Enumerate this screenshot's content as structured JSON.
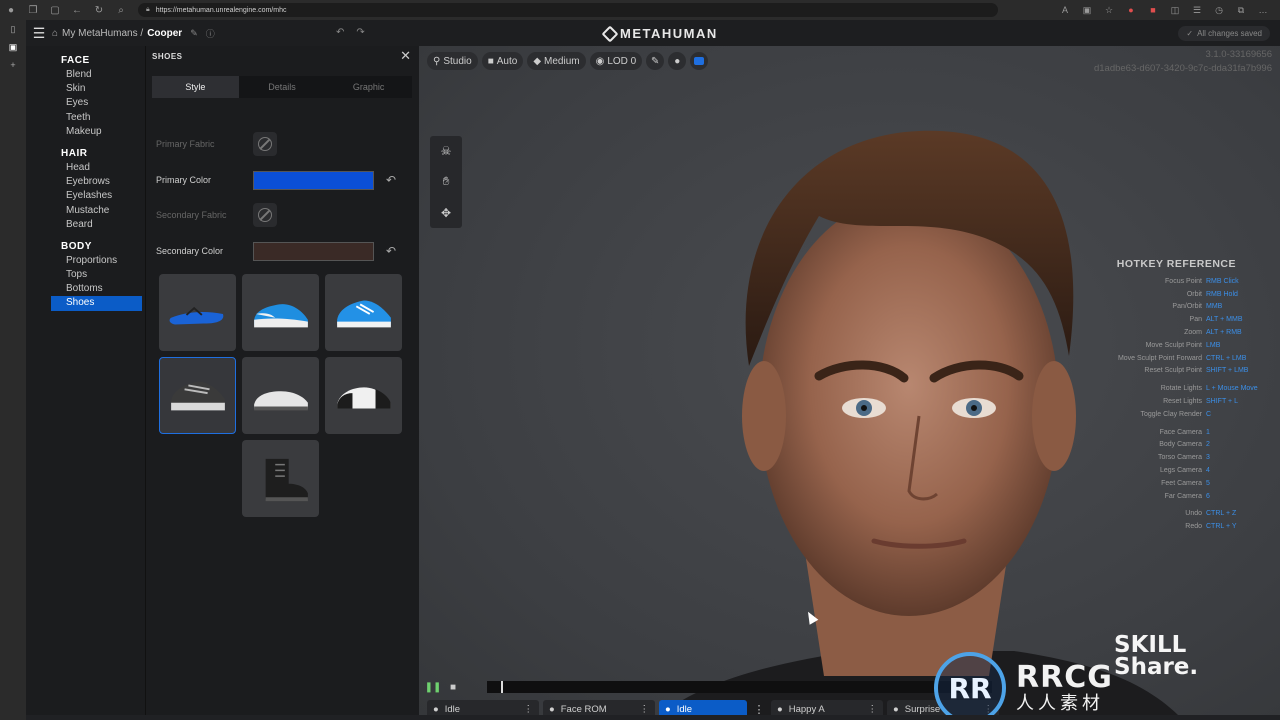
{
  "browser": {
    "url": "https://metahuman.unrealengine.com/mhc"
  },
  "header": {
    "breadcrumb_parent": "My MetaHumans /",
    "breadcrumb_current": "Cooper",
    "brand": "METAHUMAN",
    "saved_status": "All changes saved"
  },
  "categories": [
    {
      "title": "FACE",
      "items": [
        "Blend",
        "Skin",
        "Eyes",
        "Teeth",
        "Makeup"
      ]
    },
    {
      "title": "HAIR",
      "items": [
        "Head",
        "Eyebrows",
        "Eyelashes",
        "Mustache",
        "Beard"
      ]
    },
    {
      "title": "BODY",
      "items": [
        "Proportions",
        "Tops",
        "Bottoms",
        "Shoes"
      ]
    }
  ],
  "active_category": "Shoes",
  "panel": {
    "title": "SHOES",
    "tabs": [
      "Style",
      "Details",
      "Graphic"
    ],
    "active_tab": "Style",
    "primary_fabric_label": "Primary Fabric",
    "primary_color_label": "Primary Color",
    "primary_color": "#0b4fd6",
    "secondary_fabric_label": "Secondary Fabric",
    "secondary_color_label": "Secondary Color",
    "secondary_color": "#3a2a26",
    "shoes": [
      {
        "icon": "flip-flop-icon",
        "selected": false
      },
      {
        "icon": "slip-on-sneaker-icon",
        "selected": false
      },
      {
        "icon": "running-shoe-icon",
        "selected": false
      },
      {
        "icon": "chunky-sneaker-icon",
        "selected": true
      },
      {
        "icon": "loafer-icon",
        "selected": false
      },
      {
        "icon": "oxford-shoe-icon",
        "selected": false
      },
      {
        "icon": "boot-icon",
        "selected": false
      }
    ]
  },
  "viewport": {
    "toolbar": {
      "studio": "Studio",
      "auto": "Auto",
      "medium": "Medium",
      "lod": "LOD 0"
    },
    "version": "3.1.0-33169656",
    "build_id": "d1adbe63-d607-3420-9c7c-dda31fa7b996"
  },
  "hotkeys": {
    "title": "HOTKEY REFERENCE",
    "groups": [
      [
        [
          "Focus Point",
          "RMB Click"
        ],
        [
          "Orbit",
          "RMB Hold"
        ],
        [
          "Pan/Orbit",
          "MMB"
        ],
        [
          "Pan",
          "ALT + MMB"
        ],
        [
          "Zoom",
          "ALT + RMB"
        ],
        [
          "Move Sculpt Point",
          "LMB"
        ],
        [
          "Move Sculpt Point Forward",
          "CTRL + LMB"
        ],
        [
          "Reset Sculpt Point",
          "SHIFT + LMB"
        ]
      ],
      [
        [
          "Rotate Lights",
          "L + Mouse Move"
        ],
        [
          "Reset Lights",
          "SHIFT + L"
        ],
        [
          "Toggle Clay Render",
          "C"
        ]
      ],
      [
        [
          "Face Camera",
          "1"
        ],
        [
          "Body Camera",
          "2"
        ],
        [
          "Torso Camera",
          "3"
        ],
        [
          "Legs Camera",
          "4"
        ],
        [
          "Feet Camera",
          "5"
        ],
        [
          "Far Camera",
          "6"
        ]
      ],
      [
        [
          "Undo",
          "CTRL + Z"
        ],
        [
          "Redo",
          "CTRL + Y"
        ]
      ]
    ]
  },
  "animations": [
    {
      "label": "Idle",
      "active": false
    },
    {
      "label": "Face ROM",
      "active": false
    },
    {
      "label": "Idle",
      "active": true
    },
    {
      "label": "Happy A",
      "active": false
    },
    {
      "label": "Surprise",
      "active": false
    }
  ],
  "watermark": {
    "logo_text": "RR",
    "big": "RRCG",
    "small": "人人素材"
  },
  "skillshare": {
    "line1": "SKILL",
    "line2": "Share."
  }
}
